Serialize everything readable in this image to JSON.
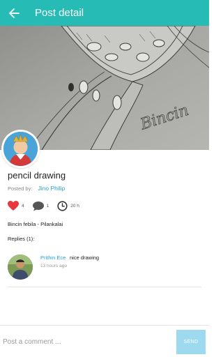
{
  "appbar": {
    "title": "Post detail",
    "back_icon": "arrow-left-icon"
  },
  "post": {
    "title": "pencil drawing",
    "posted_by_label": "Posted by:",
    "author": "Jino Philip",
    "likes": "4",
    "comments": "1",
    "age": "20 h",
    "caption": "Bincin febila - Pilankalai",
    "signature": "Bincin",
    "replies_label": "Replies (1):"
  },
  "reply": {
    "author": "Prithin Ece",
    "text": "nice drawing",
    "time": "13 hours ago"
  },
  "composer": {
    "placeholder": "Post a comment ...",
    "send_label": "SEND"
  },
  "colors": {
    "appbar": "#26bcb5",
    "link": "#26a2cf",
    "heart": "#e8383d",
    "send": "#9dd9ef"
  }
}
